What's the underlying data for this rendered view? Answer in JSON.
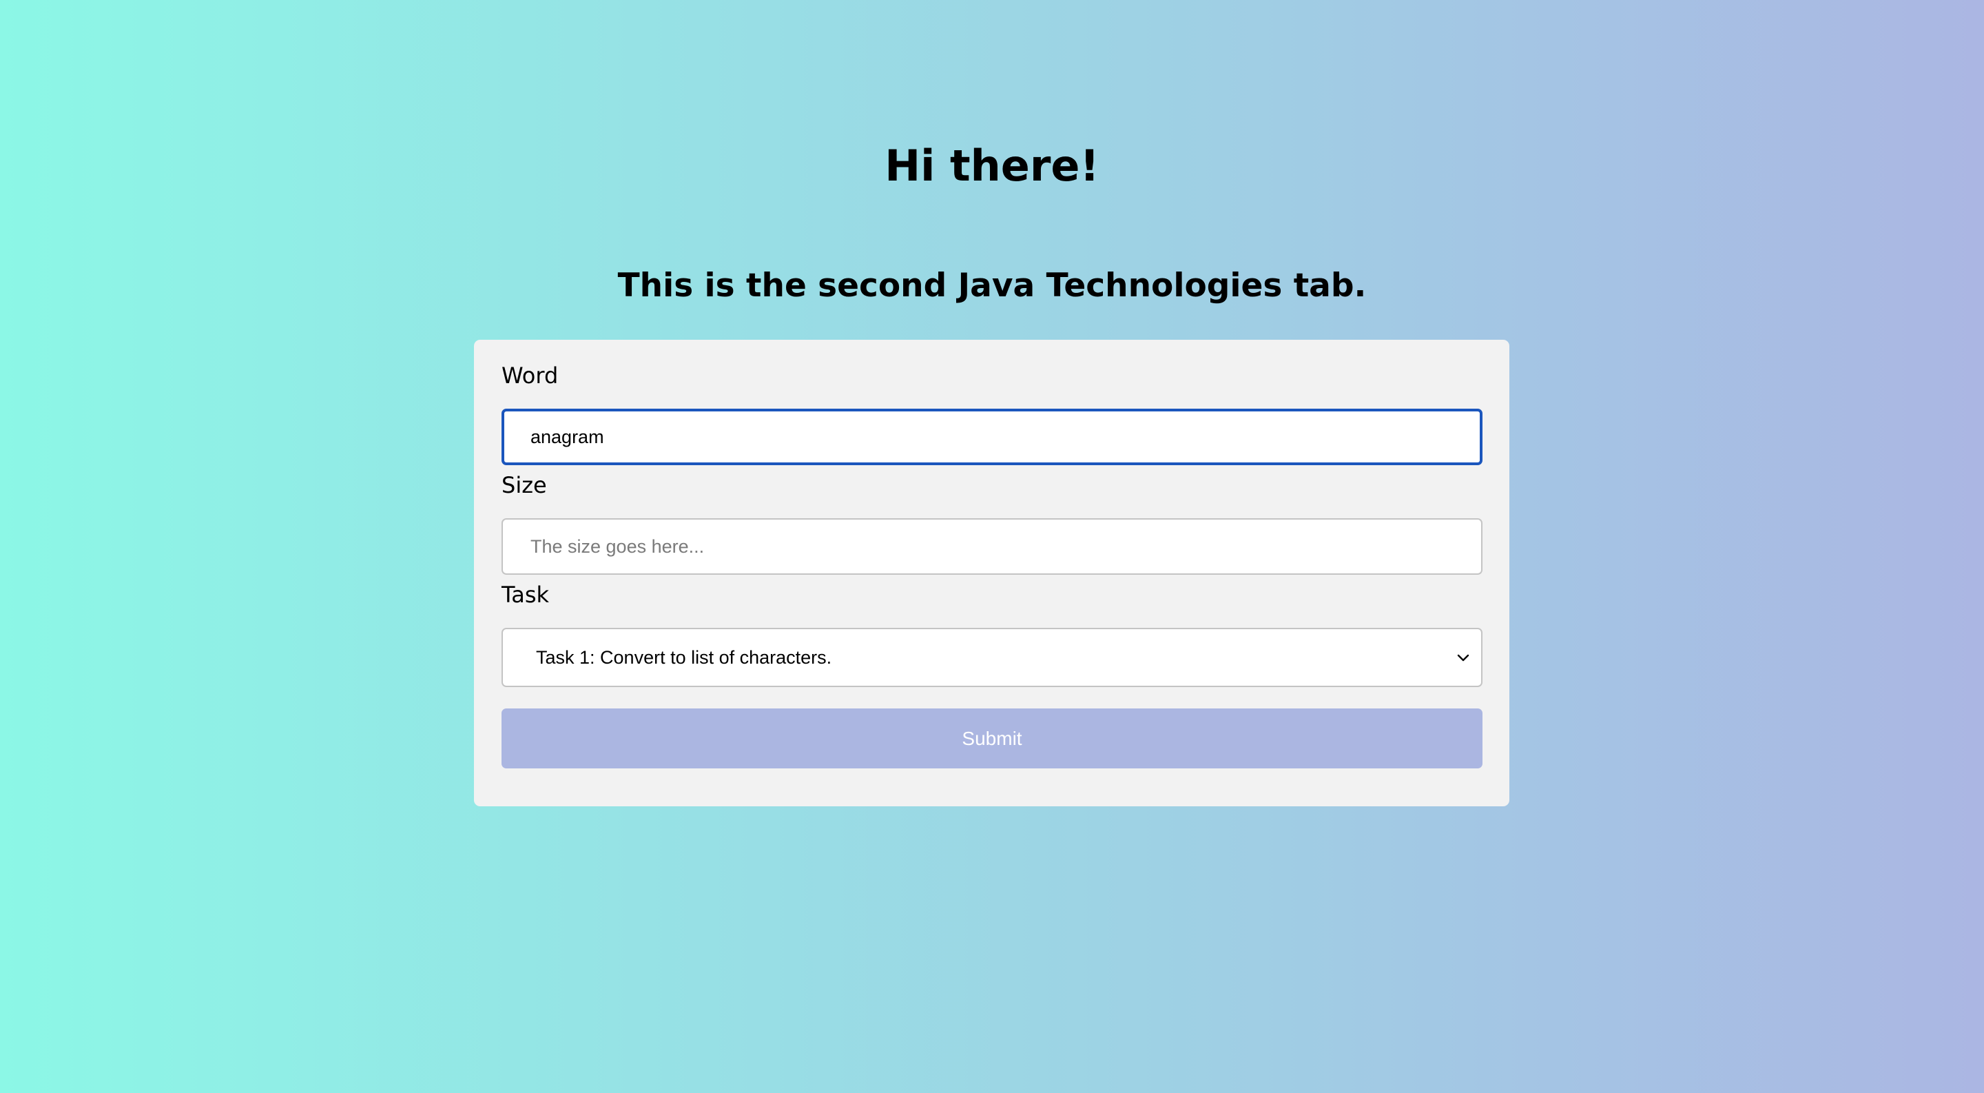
{
  "page": {
    "title": "Hi there!",
    "subtitle": "This is the second Java Technologies tab."
  },
  "form": {
    "word": {
      "label": "Word",
      "value": "anagram",
      "placeholder": ""
    },
    "size": {
      "label": "Size",
      "value": "",
      "placeholder": "The size goes here..."
    },
    "task": {
      "label": "Task",
      "selected": "Task 1: Convert to list of characters."
    },
    "submit_label": "Submit"
  },
  "colors": {
    "background_left": "#8cf7e6",
    "background_right": "#abb6e3",
    "card": "#f2f2f2",
    "focus_border": "#1b56bd",
    "submit": "#abb6e1"
  }
}
